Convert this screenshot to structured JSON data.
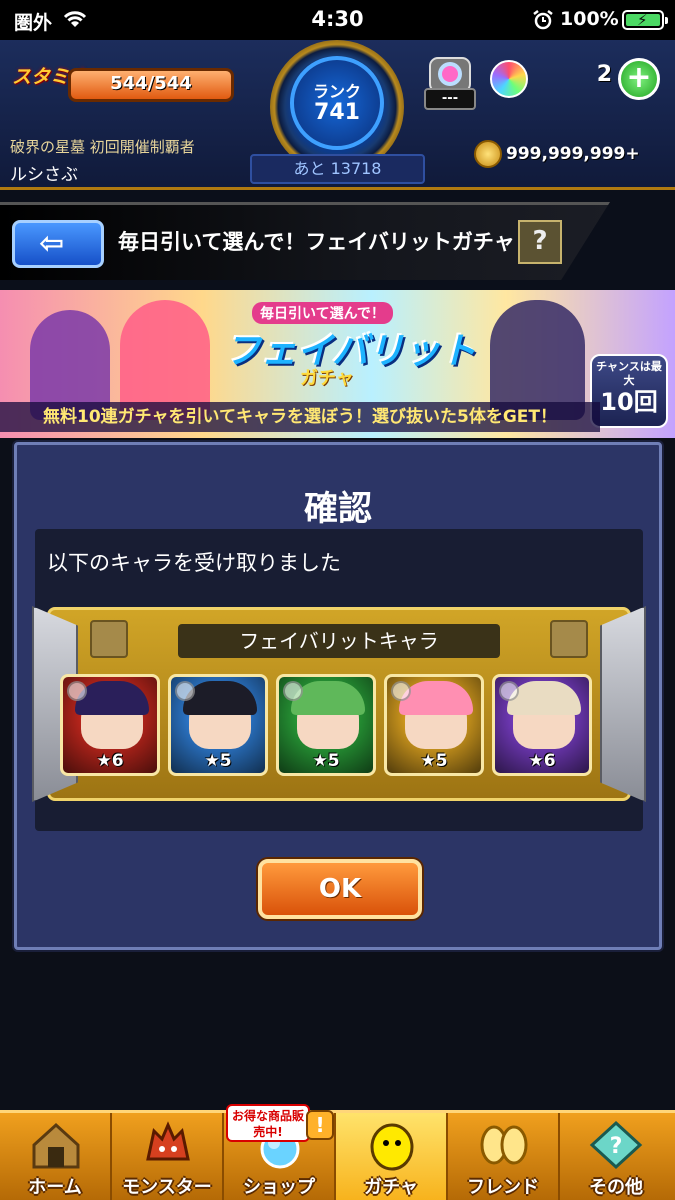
{
  "status_bar": {
    "carrier": "圏外",
    "time": "4:30",
    "battery_percent": "100%"
  },
  "header": {
    "stamina_label": "スタミナ",
    "stamina_value": "544/544",
    "rank_label": "ランク",
    "rank_value": "741",
    "rank_next": "あと 13718",
    "hatch_display": "---",
    "orb_count": "2",
    "orb_plus": "+",
    "title": "破界の星墓 初回開催制覇者",
    "user_name": "ルシさぶ",
    "coins": "999,999,999+"
  },
  "title_bar": {
    "title": "毎日引いて選んで！フェイバリットガチャ",
    "help": "?"
  },
  "banner": {
    "kicker": "毎日引いて選んで！",
    "logo": "フェイバリット",
    "logo_sub": "ガチャ",
    "chance_top": "チャンスは最大",
    "chance_bottom": "10回",
    "description": "無料10連ガチャを引いてキャラを選ぼう！選び抜いた5体をGET！"
  },
  "dialog": {
    "title": "確認",
    "message": "以下のキャラを受け取りました",
    "frame_label": "フェイバリットキャラ",
    "characters": [
      {
        "stars": "★6",
        "bg": "#c8281e",
        "hair": "#2a1f5a"
      },
      {
        "stars": "★5",
        "bg": "#2f7fd8",
        "hair": "#1c1c28"
      },
      {
        "stars": "★5",
        "bg": "#2aa33a",
        "hair": "#5fb85a"
      },
      {
        "stars": "★5",
        "bg": "#e0a520",
        "hair": "#ff8fb2"
      },
      {
        "stars": "★6",
        "bg": "#7a3ec8",
        "hair": "#e9dcc2"
      }
    ],
    "ok_label": "OK"
  },
  "bottom_nav": {
    "items": [
      {
        "label": "ホーム"
      },
      {
        "label": "モンスター"
      },
      {
        "label": "ショップ"
      },
      {
        "label": "ガチャ"
      },
      {
        "label": "フレンド"
      },
      {
        "label": "その他"
      }
    ],
    "shop_badge": "お得な商品販売中!",
    "shop_alert": "!"
  },
  "colors": {
    "accent_gold": "#d1a527",
    "dialog_bg": "#2c3566",
    "ok_orange": "#ff9a3c"
  }
}
